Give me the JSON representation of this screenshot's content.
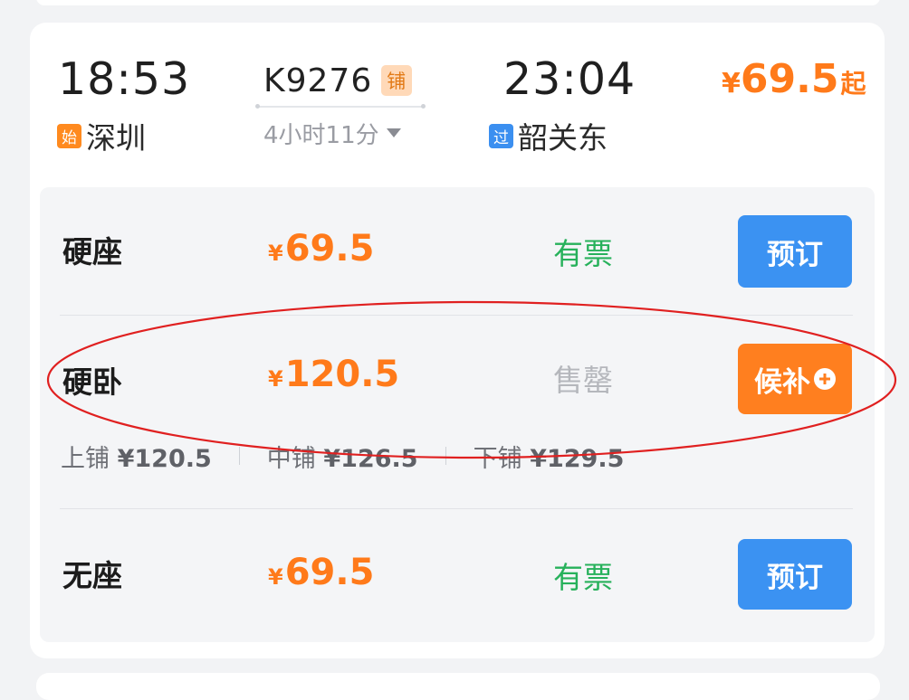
{
  "train": {
    "departure_time": "18:53",
    "departure_station": "深圳",
    "departure_badge": "始",
    "train_number": "K9276",
    "berth_tag": "铺",
    "duration": "4小时11分",
    "arrival_time": "23:04",
    "arrival_station": "韶关东",
    "arrival_badge": "过",
    "min_price_symbol": "¥",
    "min_price": "69.5",
    "min_price_suffix": "起"
  },
  "seats": [
    {
      "name": "硬座",
      "price_symbol": "¥",
      "price": "69.5",
      "status": "有票",
      "action": "预订"
    },
    {
      "name": "硬卧",
      "price_symbol": "¥",
      "price": "120.5",
      "status": "售罄",
      "action": "候补"
    },
    {
      "name": "无座",
      "price_symbol": "¥",
      "price": "69.5",
      "status": "有票",
      "action": "预订"
    }
  ],
  "berths": [
    {
      "label": "上铺",
      "price": "¥120.5"
    },
    {
      "label": "中铺",
      "price": "¥126.5"
    },
    {
      "label": "下铺",
      "price": "¥129.5"
    }
  ],
  "colors": {
    "accent_orange": "#ff7a1a",
    "book_blue": "#3b92f2",
    "available_green": "#27b15b",
    "soldout_gray": "#b5b7bc",
    "annotation_red": "#e02020"
  },
  "icons": {
    "duration_toggle": "caret-down-icon",
    "waitlist_add": "plus-circle-icon"
  }
}
